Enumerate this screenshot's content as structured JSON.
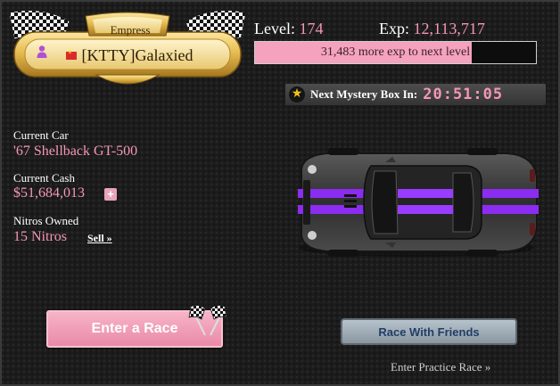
{
  "player": {
    "title": "Empress",
    "name": "[KTTY]Galaxied",
    "flag_icon": "hong-kong-flag-icon",
    "member_icon": "member-icon"
  },
  "progress": {
    "level_label": "Level:",
    "level_value": "174",
    "exp_label": "Exp:",
    "exp_value": "12,113,717",
    "exp_bar_text": "31,483 more exp to next level",
    "exp_bar_fraction": 0.77
  },
  "mystery_box": {
    "label": "Next Mystery Box In:",
    "timer": "20:51:05",
    "icon": "star-icon"
  },
  "stats": {
    "car_label": "Current Car",
    "car_value": "'67 Shellback GT-500",
    "cash_label": "Current Cash",
    "cash_value": "$51,684,013",
    "cash_add": "+",
    "nitros_label": "Nitros Owned",
    "nitros_value": "15 Nitros",
    "sell_link": "Sell »"
  },
  "actions": {
    "enter_race": "Enter a Race",
    "race_friends": "Race With Friends",
    "practice": "Enter Practice Race »"
  },
  "colors": {
    "accent_pink": "#f497b5",
    "car_body": "#3a3a3a",
    "car_stripe": "#8b2cf0",
    "badge_gold": "#e2b53f"
  }
}
